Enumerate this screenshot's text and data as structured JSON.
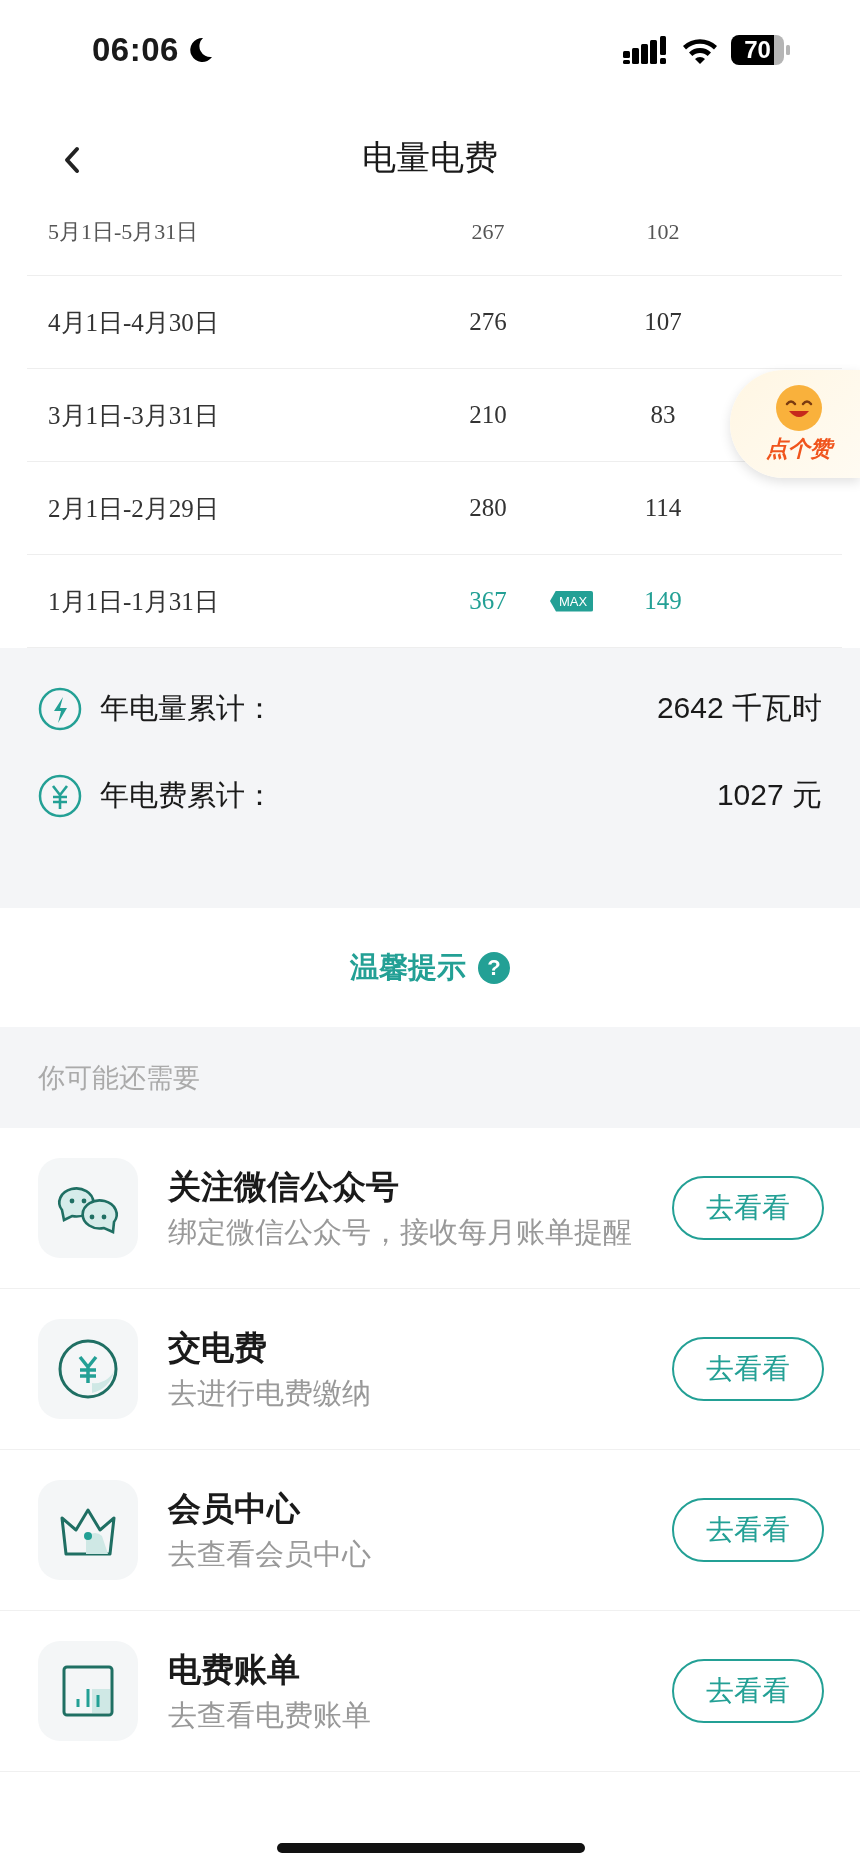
{
  "status_bar": {
    "time": "06:06",
    "battery": "70"
  },
  "nav": {
    "title": "电量电费"
  },
  "usage_rows": [
    {
      "kind": "clipped",
      "period": "5月1日-5月31日",
      "kwh": "267",
      "fee": "102",
      "highlighted": false
    },
    {
      "kind": "normal",
      "period": "4月1日-4月30日",
      "kwh": "276",
      "fee": "107",
      "highlighted": false
    },
    {
      "kind": "normal",
      "period": "3月1日-3月31日",
      "kwh": "210",
      "fee": "83",
      "highlighted": false
    },
    {
      "kind": "normal",
      "period": "2月1日-2月29日",
      "kwh": "280",
      "fee": "114",
      "highlighted": false
    },
    {
      "kind": "normal",
      "period": "1月1日-1月31日",
      "kwh": "367",
      "fee": "149",
      "highlighted": true,
      "badge": "MAX"
    }
  ],
  "like_badge": {
    "label": "点个赞"
  },
  "summary": [
    {
      "kind": "energy",
      "label": "年电量累计：",
      "value": "2642 千瓦时"
    },
    {
      "kind": "money",
      "label": "年电费累计：",
      "value": "1027 元"
    }
  ],
  "tip": {
    "label": "温馨提示",
    "help": "?"
  },
  "section_title": "你可能还需要",
  "suggestions": [
    {
      "kind": "chat",
      "title": "关注微信公众号",
      "subtitle": "绑定微信公众号，接收每月账单提醒",
      "button": "去看看"
    },
    {
      "kind": "payment",
      "title": "交电费",
      "subtitle": "去进行电费缴纳",
      "button": "去看看"
    },
    {
      "kind": "member",
      "title": "会员中心",
      "subtitle": "去查看会员中心",
      "button": "去看看"
    },
    {
      "kind": "bill",
      "title": "电费账单",
      "subtitle": "去查看电费账单",
      "button": "去看看"
    }
  ]
}
